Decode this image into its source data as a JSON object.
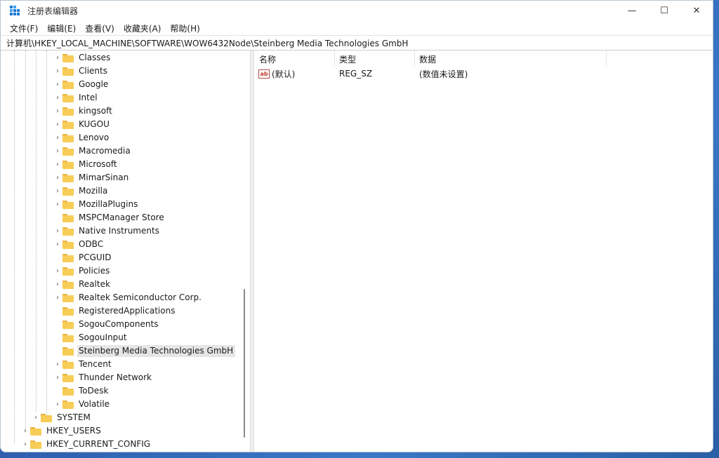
{
  "window": {
    "title": "注册表编辑器",
    "controls": {
      "minimize": "—",
      "maximize": "☐",
      "close": "✕"
    }
  },
  "menu": [
    "文件(F)",
    "编辑(E)",
    "查看(V)",
    "收藏夹(A)",
    "帮助(H)"
  ],
  "address": "计算机\\HKEY_LOCAL_MACHINE\\SOFTWARE\\WOW6432Node\\Steinberg Media Technologies GmbH",
  "tree": {
    "software_children": [
      {
        "label": "Classes",
        "expandable": true
      },
      {
        "label": "Clients",
        "expandable": true
      },
      {
        "label": "Google",
        "expandable": true
      },
      {
        "label": "Intel",
        "expandable": true
      },
      {
        "label": "kingsoft",
        "expandable": true
      },
      {
        "label": "KUGOU",
        "expandable": true
      },
      {
        "label": "Lenovo",
        "expandable": true
      },
      {
        "label": "Macromedia",
        "expandable": true
      },
      {
        "label": "Microsoft",
        "expandable": true
      },
      {
        "label": "MimarSinan",
        "expandable": true
      },
      {
        "label": "Mozilla",
        "expandable": true
      },
      {
        "label": "MozillaPlugins",
        "expandable": true
      },
      {
        "label": "MSPCManager Store",
        "expandable": false
      },
      {
        "label": "Native Instruments",
        "expandable": true
      },
      {
        "label": "ODBC",
        "expandable": true
      },
      {
        "label": "PCGUID",
        "expandable": false
      },
      {
        "label": "Policies",
        "expandable": true
      },
      {
        "label": "Realtek",
        "expandable": true
      },
      {
        "label": "Realtek Semiconductor Corp.",
        "expandable": true
      },
      {
        "label": "RegisteredApplications",
        "expandable": false
      },
      {
        "label": "SogouComponents",
        "expandable": false
      },
      {
        "label": "SogouInput",
        "expandable": false
      },
      {
        "label": "Steinberg Media Technologies GmbH",
        "expandable": false,
        "selected": true
      },
      {
        "label": "Tencent",
        "expandable": true
      },
      {
        "label": "Thunder Network",
        "expandable": true
      },
      {
        "label": "ToDesk",
        "expandable": false
      },
      {
        "label": "Volatile",
        "expandable": true
      }
    ],
    "system": {
      "label": "SYSTEM",
      "expandable": true
    },
    "roots": [
      {
        "label": "HKEY_USERS",
        "expandable": true
      },
      {
        "label": "HKEY_CURRENT_CONFIG",
        "expandable": true
      }
    ]
  },
  "list": {
    "columns": [
      "名称",
      "类型",
      "数据"
    ],
    "rows": [
      {
        "name": "(默认)",
        "type": "REG_SZ",
        "data": "(数值未设置)",
        "icon": "string-value-icon"
      }
    ]
  }
}
